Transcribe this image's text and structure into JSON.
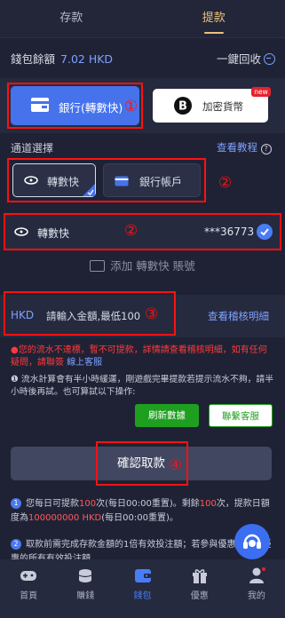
{
  "tabs": [
    "存款",
    "提款"
  ],
  "wallet": {
    "label": "錢包餘額",
    "amount": "7.02 HKD",
    "recall": "一鍵回收"
  },
  "pay_types": {
    "bank": "銀行(轉數快)",
    "crypto": "加密貨幣",
    "new_badge": "new"
  },
  "channel": {
    "label": "通道選擇",
    "tutorial": "查看教程",
    "options": [
      "轉數快",
      "銀行帳戶"
    ]
  },
  "account": {
    "name": "轉數快",
    "number": "***36773"
  },
  "add_account": "添加 轉數快 賬號",
  "amount_input": {
    "currency": "HKD",
    "placeholder": "請輸入金額,最低100",
    "check_link": "查看稽核明細"
  },
  "warning": "●您的流水不達標，暫不可提款，詳情請查看稽核明細，如有任何疑問，請聯簽 ",
  "warning_link": "線上客服",
  "note": "❶ 流水計算會有半小時緩運，剛遊戲完畢提款若提示流水不夠，請半小時後再試。也可算試以下操作:",
  "buttons": {
    "refresh": "刷新數據",
    "contact": "聯繫客服",
    "confirm": "確認取款"
  },
  "info1": {
    "num": "1",
    "pre": "您每日可提款",
    "times": "100",
    "mid": "次(每日00:00重置)。剩餘",
    "left": "100",
    "mid2": "次，提款日額度為",
    "quota": "100000000 HKD",
    "post": "(每日00:00重置)。"
  },
  "info2": {
    "num": "2",
    "text": "取款前需完成存款金額的1倍有效投注額；若參與優惠需完成優惠的所有有效投注額"
  },
  "annotations": [
    "①",
    "②",
    "②",
    "③",
    "④"
  ],
  "nav": [
    "首頁",
    "賺錢",
    "錢包",
    "優惠",
    "我的"
  ],
  "colors": {
    "bg": "#1f2235",
    "accent": "#4673ec",
    "gold": "#e9c37a",
    "danger": "#ff1010",
    "green": "#1f9f1f"
  }
}
